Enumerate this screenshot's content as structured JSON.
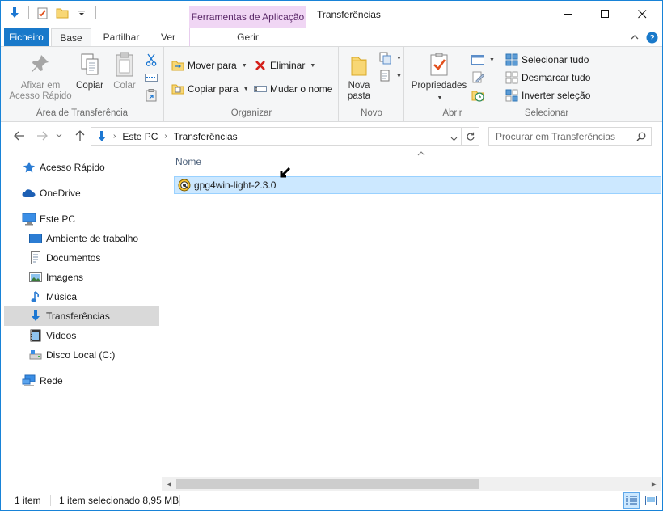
{
  "window": {
    "title": "Transferências",
    "context_tab_header": "Ferramentas de Aplicação",
    "accent_color": "#1979ca"
  },
  "tabs": {
    "file": "Ficheiro",
    "home": "Base",
    "share": "Partilhar",
    "view": "Ver",
    "manage": "Gerir"
  },
  "ribbon": {
    "clipboard": {
      "label": "Área de Transferência",
      "pin": "Afixar em\nAcesso Rápido",
      "copy": "Copiar",
      "paste": "Colar"
    },
    "organize": {
      "label": "Organizar",
      "move_to": "Mover para",
      "copy_to": "Copiar para",
      "delete": "Eliminar",
      "rename": "Mudar o nome"
    },
    "new": {
      "label": "Novo",
      "new_folder": "Nova\npasta"
    },
    "open": {
      "label": "Abrir",
      "properties": "Propriedades"
    },
    "select": {
      "label": "Selecionar",
      "select_all": "Selecionar tudo",
      "select_none": "Desmarcar tudo",
      "invert": "Inverter seleção"
    }
  },
  "address": {
    "crumbs": [
      "Este PC",
      "Transferências"
    ],
    "search_placeholder": "Procurar em Transferências"
  },
  "navpane": {
    "items": [
      {
        "label": "Acesso Rápido",
        "icon": "star-icon"
      },
      {
        "label": "OneDrive",
        "icon": "cloud-icon"
      },
      {
        "label": "Este PC",
        "icon": "computer-icon"
      },
      {
        "label": "Ambiente de trabalho",
        "icon": "desktop-icon"
      },
      {
        "label": "Documentos",
        "icon": "document-icon"
      },
      {
        "label": "Imagens",
        "icon": "pictures-icon"
      },
      {
        "label": "Música",
        "icon": "music-icon"
      },
      {
        "label": "Transferências",
        "icon": "download-icon",
        "selected": true
      },
      {
        "label": "Vídeos",
        "icon": "video-icon"
      },
      {
        "label": "Disco Local (C:)",
        "icon": "drive-icon"
      },
      {
        "label": "Rede",
        "icon": "network-icon"
      }
    ]
  },
  "filelist": {
    "column_name": "Nome",
    "files": [
      {
        "name": "gpg4win-light-2.3.0",
        "icon": "gpg4win-installer-icon",
        "selected": true
      }
    ]
  },
  "status": {
    "count": "1 item",
    "selection": "1 item selecionado 8,95 MB"
  }
}
